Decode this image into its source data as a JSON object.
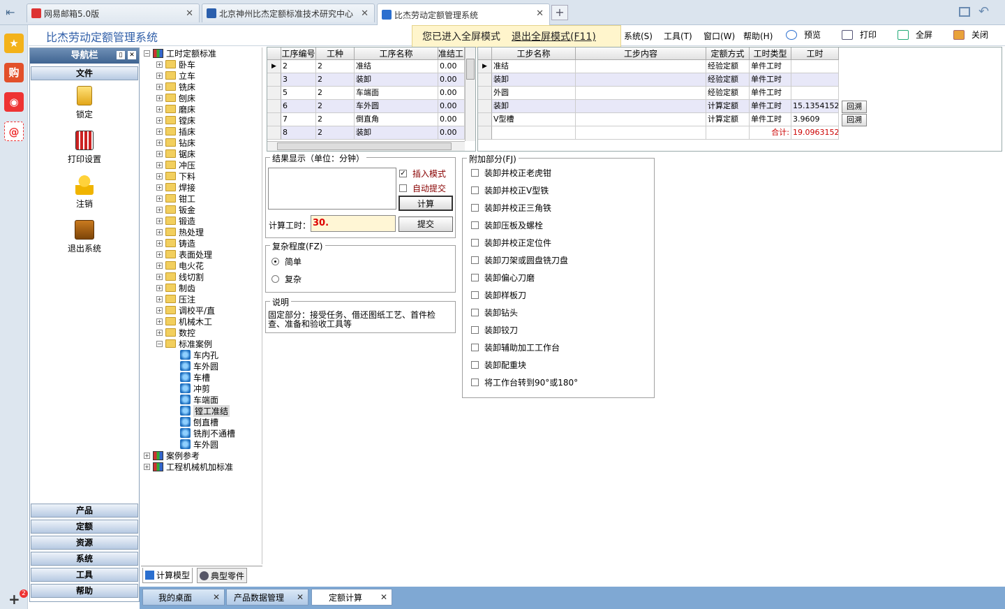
{
  "browser": {
    "tabs": [
      {
        "label": "网易邮箱5.0版",
        "color": "#d33"
      },
      {
        "label": "北京神州比杰定额标准技术研究中心",
        "color": "#2b5fad"
      },
      {
        "label": "比杰劳动定额管理系统",
        "color": "#2b6fcf"
      }
    ],
    "new_tab": "+",
    "notification_count": "2"
  },
  "app": {
    "title": "比杰劳动定额管理系统",
    "fullscreen_banner": "您已进入全屏模式",
    "exit_fullscreen": "退出全屏模式(F11)",
    "menus": [
      "系统(S)",
      "工具(T)",
      "窗口(W)",
      "帮助(H)"
    ],
    "toolbar": [
      "预览",
      "打印",
      "全屏",
      "关闭"
    ]
  },
  "nav": {
    "header": "导航栏",
    "section_top": "文件",
    "items": [
      "锁定",
      "打印设置",
      "注销",
      "退出系统"
    ],
    "sections_bottom": [
      "产品",
      "定额",
      "资源",
      "系统",
      "工具",
      "帮助"
    ]
  },
  "tree": {
    "root": "工时定额标准",
    "folders": [
      "卧车",
      "立车",
      "铣床",
      "刨床",
      "磨床",
      "镗床",
      "插床",
      "钻床",
      "锯床",
      "冲压",
      "下料",
      "焊接",
      "钳工",
      "钣金",
      "锻造",
      "热处理",
      "铸造",
      "表面处理",
      "电火花",
      "线切割",
      "制齿",
      "压注",
      "调校平/直",
      "机械木工",
      "数控"
    ],
    "open_folder": "标准案例",
    "leaves": [
      "车内孔",
      "车外圆",
      "车槽",
      "冲剪",
      "车端面",
      "镗工准结",
      "刨直槽",
      "铣削不通槽",
      "车外圆"
    ],
    "selected_leaf": "镗工准结",
    "other_roots": [
      "案例参考",
      "工程机械机加标准"
    ],
    "tabs": [
      "计算模型",
      "典型零件"
    ]
  },
  "process_grid": {
    "headers": [
      "工序编号",
      "工种",
      "工序名称",
      "准结工"
    ],
    "rows": [
      [
        "2",
        "2",
        "准结",
        "0.00"
      ],
      [
        "3",
        "2",
        "装卸",
        "0.00"
      ],
      [
        "5",
        "2",
        "车端面",
        "0.00"
      ],
      [
        "6",
        "2",
        "车外圆",
        "0.00"
      ],
      [
        "7",
        "2",
        "倒直角",
        "0.00"
      ],
      [
        "8",
        "2",
        "装卸",
        "0.00"
      ]
    ]
  },
  "step_grid": {
    "headers": [
      "工步名称",
      "工步内容",
      "定额方式",
      "工时类型",
      "工时"
    ],
    "rows": [
      [
        "准结",
        "",
        "经验定额",
        "单件工时",
        ""
      ],
      [
        "装卸",
        "",
        "经验定额",
        "单件工时",
        ""
      ],
      [
        "外圆",
        "",
        "经验定额",
        "单件工时",
        ""
      ],
      [
        "装卸",
        "",
        "计算定额",
        "单件工时",
        "15.1354152"
      ],
      [
        "V型槽",
        "",
        "计算定额",
        "单件工时",
        "3.9609"
      ]
    ],
    "total_label": "合计:",
    "total_value": "19.0963152",
    "backtrack": "回溯"
  },
  "result": {
    "legend": "结果显示（单位：分钟）",
    "insert_mode": "插入模式",
    "auto_submit": "自动提交",
    "calc_button": "计算",
    "submit_button": "提交",
    "calc_label": "计算工时：",
    "calc_value": "30."
  },
  "complexity": {
    "legend": "复杂程度(FZ)",
    "options": [
      "简单",
      "复杂"
    ]
  },
  "description": {
    "legend": "说明",
    "text": "固定部分：接受任务、借还图纸工艺、首件检查、准备和验收工具等"
  },
  "extra": {
    "legend": "附加部分(FJ)",
    "items": [
      "装卸并校正老虎钳",
      "装卸并校正V型铁",
      "装卸并校正三角铁",
      "装卸压板及螺栓",
      "装卸并校正定位件",
      "装卸刀架或圆盘铣刀盘",
      "装卸偏心刀磨",
      "装卸样板刀",
      "装卸钻头",
      "装卸铰刀",
      "装卸辅助加工工作台",
      "装卸配重块",
      "将工作台转到90°或180°"
    ]
  },
  "bottom_tabs": [
    "我的桌面",
    "产品数据管理",
    "定额计算"
  ]
}
